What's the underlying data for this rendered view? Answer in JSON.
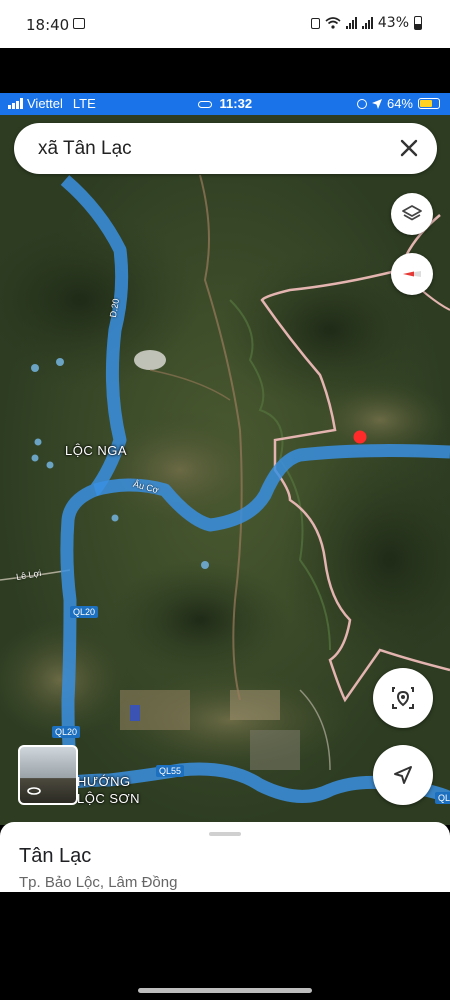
{
  "android_status": {
    "time": "18:40",
    "battery": "43%"
  },
  "ios_status": {
    "carrier": "Viettel",
    "network": "LTE",
    "time": "11:32",
    "battery": "64%"
  },
  "search": {
    "query": "xã Tân Lạc",
    "close_icon": "close-icon"
  },
  "map": {
    "place_labels": [
      "LỘC NGA",
      "HƯỚNG",
      "LỘC SƠN"
    ],
    "road_labels": [
      "D.20",
      "QL20",
      "QL20",
      "QL55",
      "Âu Cơ",
      "Lê Lợi",
      "QL"
    ],
    "controls": [
      "layers-icon",
      "compass-icon",
      "location-pin-icon",
      "navigate-icon"
    ],
    "colors": {
      "route": "#3a8fe0",
      "boundary": "#e3b4b0",
      "marker": "#ff2a2a"
    }
  },
  "sheet": {
    "title": "Tân Lạc",
    "address": "Tp. Bảo Lộc, Lâm Đồng"
  }
}
